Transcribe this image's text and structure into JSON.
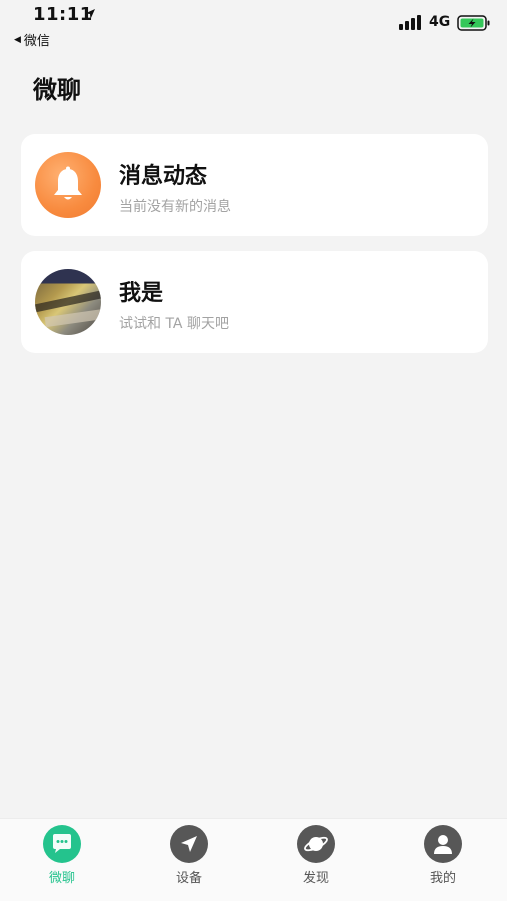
{
  "status_bar": {
    "time": "11:11",
    "back_label": "微信",
    "network": "4G"
  },
  "page": {
    "title": "微聊"
  },
  "conversations": [
    {
      "title": "消息动态",
      "subtitle": "当前没有新的消息",
      "avatar_icon": "bell-icon",
      "avatar_color": "#f88b3f"
    },
    {
      "title": "我是",
      "subtitle": "试试和 TA 聊天吧",
      "avatar_icon": "user-photo"
    }
  ],
  "tab_bar": {
    "active_color": "#24c38d",
    "inactive_color": "#575757",
    "tabs": [
      {
        "label": "微聊",
        "icon": "chat-bubble-icon",
        "active": true
      },
      {
        "label": "设备",
        "icon": "send-arrow-icon",
        "active": false
      },
      {
        "label": "发现",
        "icon": "planet-icon",
        "active": false
      },
      {
        "label": "我的",
        "icon": "person-icon",
        "active": false
      }
    ]
  }
}
